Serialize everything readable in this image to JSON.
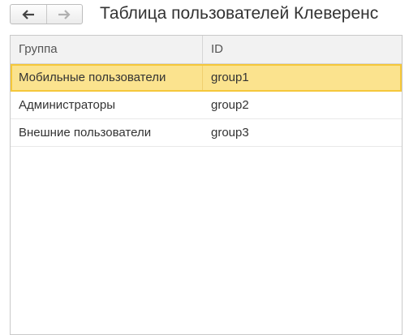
{
  "window": {
    "title": "Таблица пользователей Клеверенс",
    "nav_back_icon": "arrow-left-icon",
    "nav_forward_icon": "arrow-right-icon"
  },
  "grid": {
    "columns": [
      "Группа",
      "ID"
    ],
    "rows": [
      {
        "group": "Мобильные пользователи",
        "id": "group1",
        "selected": true
      },
      {
        "group": "Администраторы",
        "id": "group2",
        "selected": false
      },
      {
        "group": "Внешние пользователи",
        "id": "group3",
        "selected": false
      }
    ]
  },
  "colors": {
    "selection_fill": "#fbe38e",
    "selection_border": "#f5c73a",
    "header_bg": "#f2f2f2"
  }
}
